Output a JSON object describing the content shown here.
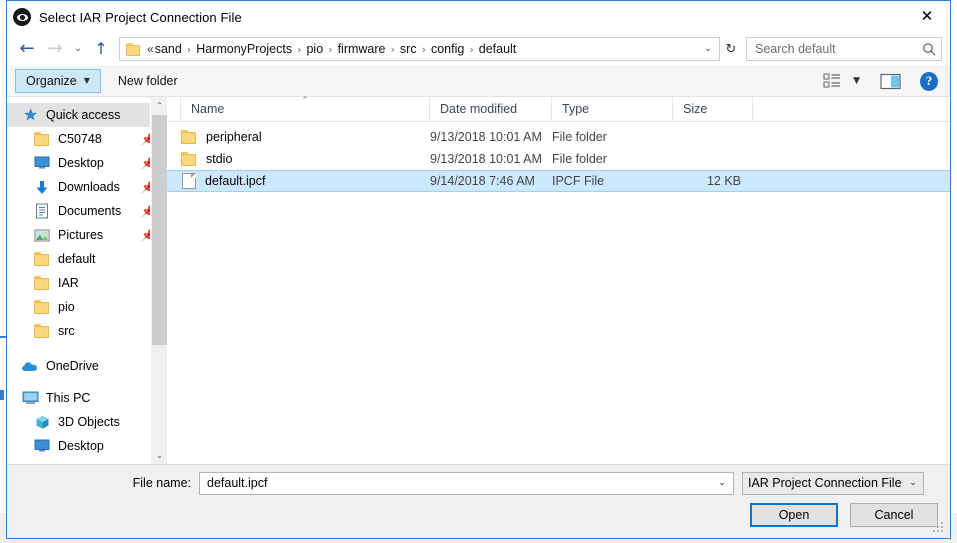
{
  "window": {
    "title": "Select IAR Project Connection File",
    "app_icon": "iar-eye-icon",
    "close_label": "✕"
  },
  "addressbar": {
    "back_icon": "←",
    "forward_icon": "→",
    "recent_icon": "⌄",
    "up_icon": "↑",
    "folder_icon": "folder-icon",
    "ellipsis": "«",
    "separator": "›",
    "crumbs": [
      {
        "label": "sand"
      },
      {
        "label": "HarmonyProjects"
      },
      {
        "label": "pio"
      },
      {
        "label": "firmware"
      },
      {
        "label": "src"
      },
      {
        "label": "config"
      },
      {
        "label": "default"
      }
    ],
    "crumb_dropdown_icon": "⌄",
    "refresh_icon": "↻",
    "search": {
      "placeholder": "Search default",
      "value": "",
      "icon": "search-icon"
    }
  },
  "commandbar": {
    "organize_label": "Organize",
    "organize_caret": "▼",
    "new_folder_label": "New folder",
    "view_icon": "view-layout-icon",
    "view_caret": "▼",
    "preview_pane_icon": "preview-pane-icon",
    "help_label": "?"
  },
  "navpane": {
    "items": [
      {
        "label": "Quick access",
        "icon": "star-pin-icon",
        "selected": true,
        "level": 0,
        "pinned": false
      },
      {
        "label": "C50748",
        "icon": "folder-icon",
        "selected": false,
        "level": 1,
        "pinned": true
      },
      {
        "label": "Desktop",
        "icon": "desktop-icon",
        "selected": false,
        "level": 1,
        "pinned": true
      },
      {
        "label": "Downloads",
        "icon": "download-icon",
        "selected": false,
        "level": 1,
        "pinned": true
      },
      {
        "label": "Documents",
        "icon": "documents-icon",
        "selected": false,
        "level": 1,
        "pinned": true
      },
      {
        "label": "Pictures",
        "icon": "pictures-icon",
        "selected": false,
        "level": 1,
        "pinned": true
      },
      {
        "label": "default",
        "icon": "folder-icon",
        "selected": false,
        "level": 1,
        "pinned": false
      },
      {
        "label": "IAR",
        "icon": "folder-icon",
        "selected": false,
        "level": 1,
        "pinned": false
      },
      {
        "label": "pio",
        "icon": "folder-icon",
        "selected": false,
        "level": 1,
        "pinned": false
      },
      {
        "label": "src",
        "icon": "folder-icon",
        "selected": false,
        "level": 1,
        "pinned": false
      },
      {
        "label": "OneDrive",
        "icon": "onedrive-cloud-icon",
        "selected": false,
        "level": 0,
        "pinned": false
      },
      {
        "label": "This PC",
        "icon": "this-pc-icon",
        "selected": false,
        "level": 0,
        "pinned": false
      },
      {
        "label": "3D Objects",
        "icon": "3d-objects-icon",
        "selected": false,
        "level": 1,
        "pinned": false
      },
      {
        "label": "Desktop",
        "icon": "desktop-icon",
        "selected": false,
        "level": 1,
        "pinned": false
      }
    ],
    "scroll_up_icon": "⌃",
    "scroll_down_icon": "⌄"
  },
  "filelist": {
    "columns": [
      {
        "label": "Name",
        "sorted": "asc",
        "sort_caret": "⌃"
      },
      {
        "label": "Date modified",
        "sorted": "",
        "sort_caret": ""
      },
      {
        "label": "Type",
        "sorted": "",
        "sort_caret": ""
      },
      {
        "label": "Size",
        "sorted": "",
        "sort_caret": ""
      }
    ],
    "rows": [
      {
        "name": "peripheral",
        "date": "9/13/2018 10:01 AM",
        "type": "File folder",
        "size": "",
        "icon": "folder-icon",
        "selected": false
      },
      {
        "name": "stdio",
        "date": "9/13/2018 10:01 AM",
        "type": "File folder",
        "size": "",
        "icon": "folder-icon",
        "selected": false
      },
      {
        "name": "default.ipcf",
        "date": "9/14/2018 7:46 AM",
        "type": "IPCF File",
        "size": "12 KB",
        "icon": "file-icon",
        "selected": true
      }
    ]
  },
  "footer": {
    "filename_label": "File name:",
    "filename_value": "default.ipcf",
    "filename_chevron": "⌄",
    "filter_value": "IAR Project Connection File (*.ip",
    "filter_chevron": "⌄",
    "open_label": "Open",
    "cancel_label": "Cancel"
  },
  "colors": {
    "selection": "#cce8ff",
    "accent": "#0078d7",
    "window_border": "#2d7dd2",
    "folder": "#fcd77f",
    "help_blue": "#1a6fc4"
  }
}
